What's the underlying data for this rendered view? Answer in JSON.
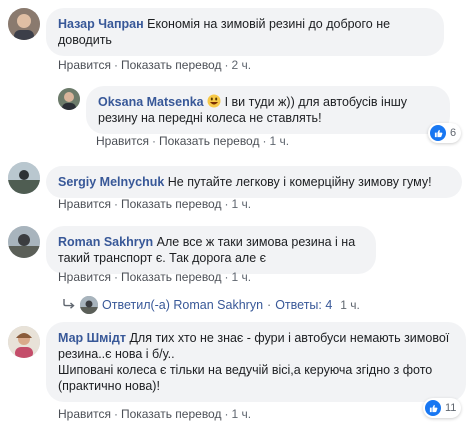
{
  "comments": [
    {
      "author": "Назар Чапран",
      "text": "Економія на зимовій резині до доброго не доводить",
      "actions": {
        "reply": "Нравится",
        "translate": "Показать перевод",
        "time": "2 ч."
      }
    },
    {
      "author": "Oksana Matsenka",
      "text": " I ви туди ж)) для автобусів іншу резину на передні колеса не ставлять!",
      "emoji": "grinning-face-emoji",
      "actions": {
        "reply": "Нравится",
        "translate": "Показать перевод",
        "time": "1 ч."
      },
      "reactions": {
        "icon": "like-icon",
        "count": "6"
      }
    },
    {
      "author": "Sergiy Melnychuk",
      "text": "Не путайте легкову і комерційну зимову гуму!",
      "actions": {
        "reply": "Нравится",
        "translate": "Показать перевод",
        "time": "1 ч."
      }
    },
    {
      "author": "Roman Sakhryn",
      "text": "Але все ж таки зимова резина і на такий транспорт є. Так дорога але є",
      "actions": {
        "reply": "Нравится",
        "translate": "Показать перевод",
        "time": "1 ч."
      },
      "replies_link": {
        "text": "Ответил(-а) Roman Sakhryn",
        "sep": "·",
        "count_text": "Ответы: 4",
        "time": "1 ч."
      }
    },
    {
      "author": "Мар Шмідт",
      "text1": "Для тих хто не знає - фури і автобуси немають зимової резина..є нова і б/у..",
      "text2": "Шиповані колеса є тільки на ведучій вісі,а керуюча згідно з фото (практично нова)!",
      "actions": {
        "reply": "Нравится",
        "translate": "Показать перевод",
        "time": "1 ч."
      },
      "reactions": {
        "icon": "like-icon",
        "count": "11"
      }
    }
  ],
  "separator": "·",
  "colors": {
    "author": "#385898",
    "bubble": "#f2f3f5",
    "like": "#1877f2"
  }
}
